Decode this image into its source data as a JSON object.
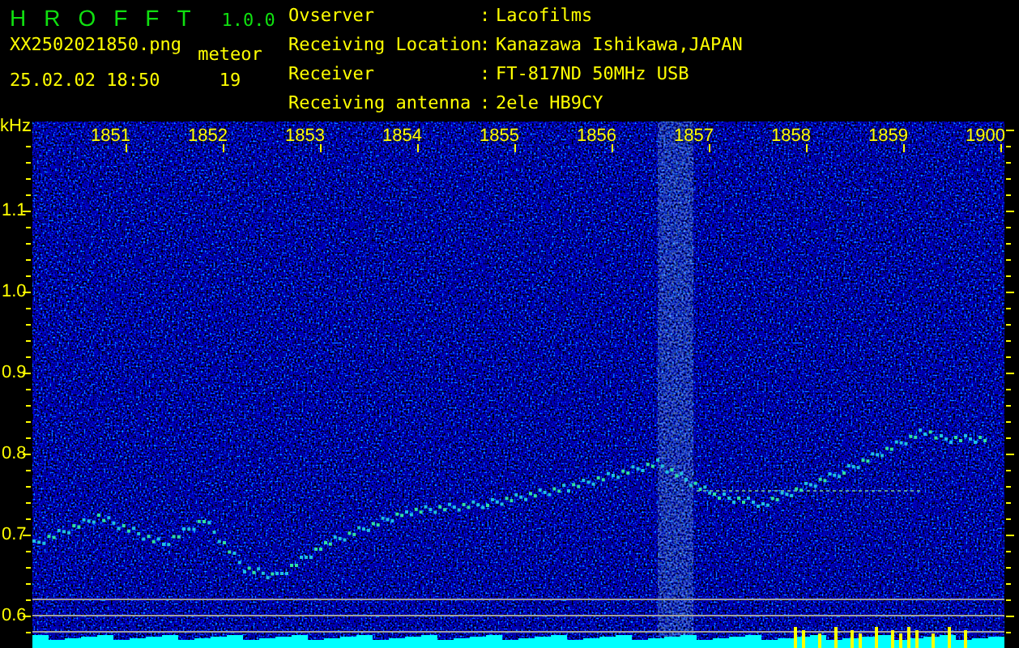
{
  "app": {
    "name": "HROFFT",
    "version": "1.0.0"
  },
  "file": "XX2502021850.png",
  "timestamp": "25.02.02 18:50",
  "meteor": {
    "label": "meteor",
    "count": "19"
  },
  "station": [
    {
      "label": "Ovserver",
      "separator": ":",
      "value": "Lacofilms"
    },
    {
      "label": "Receiving Location",
      "separator": ":",
      "value": "Kanazawa Ishikawa,JAPAN"
    },
    {
      "label": "Receiver",
      "separator": ":",
      "value": "FT-817ND 50MHz USB"
    },
    {
      "label": "Receiving antenna",
      "separator": ":",
      "value": "2ele HB9CY"
    }
  ],
  "spectrogram": {
    "unit": "kHz",
    "y_labels": [
      "1.1",
      "1.0",
      "0.9",
      "0.8",
      "0.7",
      "0.6"
    ],
    "time_labels": [
      "1851",
      "1852",
      "1853",
      "1854",
      "1855",
      "1856",
      "1857",
      "1858",
      "1859",
      "1900"
    ]
  }
}
